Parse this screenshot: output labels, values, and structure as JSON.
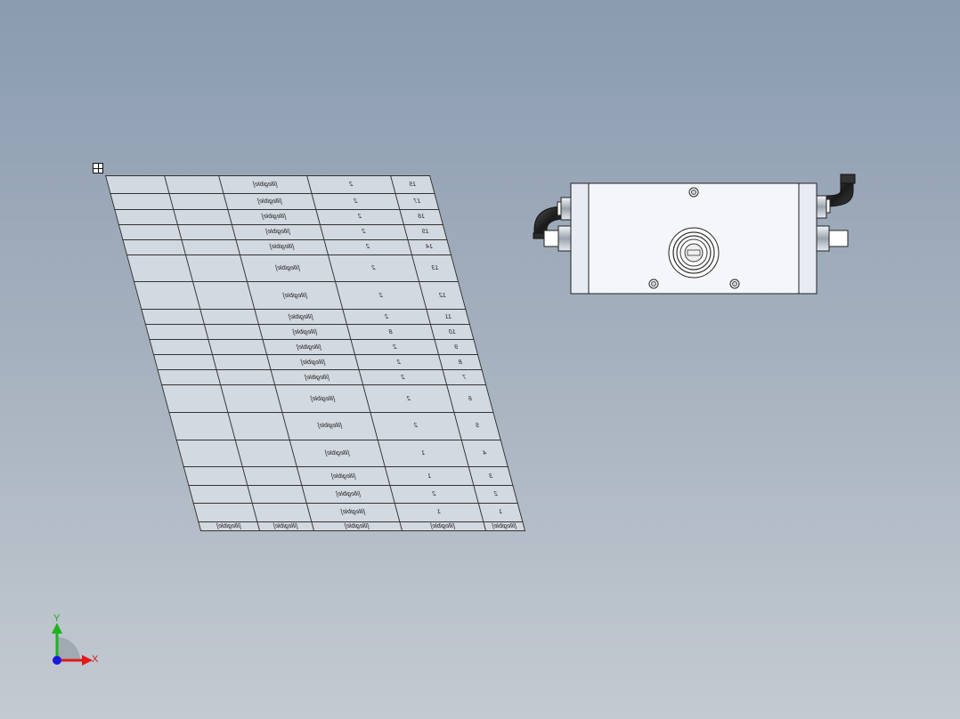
{
  "bom": {
    "rows": [
      [
        "15",
        "2",
        "[illegible]",
        "",
        ""
      ],
      [
        "17",
        "2",
        "[illegible]",
        "",
        ""
      ],
      [
        "16",
        "2",
        "[illegible]",
        "",
        ""
      ],
      [
        "15",
        "2",
        "[illegible]",
        "",
        ""
      ],
      [
        "14",
        "2",
        "[illegible]",
        "",
        ""
      ],
      [
        "13",
        "2",
        "[illegible]",
        "",
        ""
      ],
      [
        "12",
        "2",
        "[illegible]",
        "",
        ""
      ],
      [
        "11",
        "2",
        "[illegible]",
        "",
        ""
      ],
      [
        "10",
        "8",
        "[illegible]",
        "",
        ""
      ],
      [
        "9",
        "2",
        "[illegible]",
        "",
        ""
      ],
      [
        "8",
        "2",
        "[illegible]",
        "",
        ""
      ],
      [
        "7",
        "2",
        "[illegible]",
        "",
        ""
      ],
      [
        "6",
        "2",
        "[illegible]",
        "",
        ""
      ],
      [
        "5",
        "2",
        "[illegible]",
        "",
        ""
      ],
      [
        "4",
        "1",
        "[illegible]",
        "",
        ""
      ],
      [
        "3",
        "1",
        "[illegible]",
        "",
        ""
      ],
      [
        "2",
        "2",
        "[illegible]",
        "",
        ""
      ],
      [
        "1",
        "1",
        "[illegible]",
        "",
        ""
      ]
    ],
    "header": [
      "[illegible]",
      "[illegible]",
      "[illegible]",
      "[illegible]",
      "[illegible]"
    ]
  },
  "triad": {
    "x_label": "X",
    "y_label": "Y"
  }
}
